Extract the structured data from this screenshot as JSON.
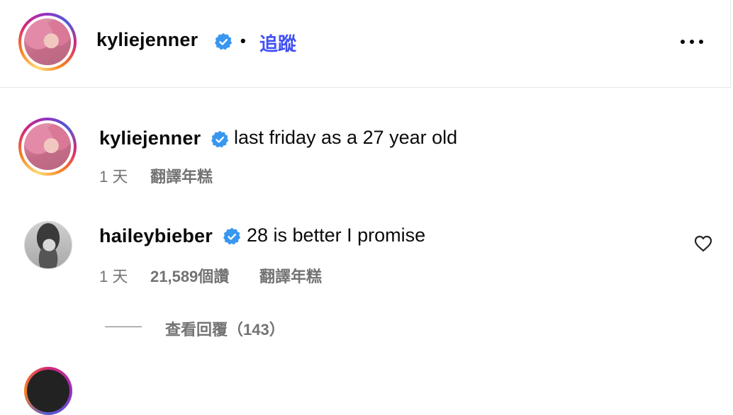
{
  "header": {
    "username": "kyliejenner",
    "separator": "•",
    "follow_label": "追蹤",
    "more_icon": "more-horizontal-icon"
  },
  "caption": {
    "username": "kyliejenner",
    "text": "last friday as a 27 year old",
    "time": "1 天",
    "translate_label": "翻譯年糕"
  },
  "comments": [
    {
      "username": "haileybieber",
      "text": "28 is better I promise",
      "time": "1 天",
      "likes": "21,589個讚",
      "translate_label": "翻譯年糕",
      "view_replies": "查看回覆（143）",
      "like_icon": "heart-outline-icon"
    }
  ],
  "colors": {
    "verified": "#3897f0",
    "follow": "#4150f7",
    "secondary_text": "#737373"
  }
}
